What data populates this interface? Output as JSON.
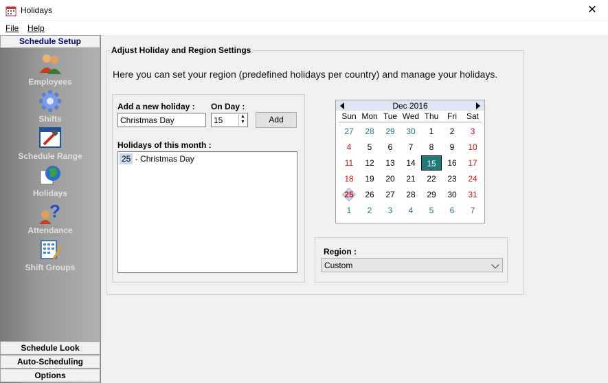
{
  "window": {
    "title": "Holidays"
  },
  "menu": {
    "file_label": "File",
    "help_label": "Help"
  },
  "sidebar": {
    "header": "Schedule Setup",
    "items": [
      {
        "label": "Employees",
        "icon": "employees-icon"
      },
      {
        "label": "Shifts",
        "icon": "gear-icon"
      },
      {
        "label": "Schedule Range",
        "icon": "schedule-range-icon"
      },
      {
        "label": "Holidays",
        "icon": "globe-icon"
      },
      {
        "label": "Attendance",
        "icon": "question-person-icon"
      },
      {
        "label": "Shift Groups",
        "icon": "calculator-icon"
      }
    ],
    "bottom": [
      "Schedule Look",
      "Auto-Scheduling",
      "Options"
    ]
  },
  "main": {
    "group_title": "Adjust Holiday and Region Settings",
    "intro": "Here you can set your region (predefined holidays per country) and manage your holidays.",
    "add_holiday_label": "Add a new holiday :",
    "on_day_label": "On Day :",
    "holiday_name_value": "Christmas Day",
    "day_value": "15",
    "add_button": "Add",
    "month_holidays_label": "Holidays of this month :",
    "holidays": [
      {
        "day": "25",
        "name": "- Christmas Day"
      }
    ],
    "region_label": "Region :",
    "region_value": "Custom"
  },
  "calendar": {
    "month": "Dec 2016",
    "weekdays": [
      "Sun",
      "Mon",
      "Tue",
      "Wed",
      "Thu",
      "Fri",
      "Sat"
    ],
    "weeks": [
      [
        "27",
        "28",
        "29",
        "30",
        "1",
        "2",
        "3"
      ],
      [
        "4",
        "5",
        "6",
        "7",
        "8",
        "9",
        "10"
      ],
      [
        "11",
        "12",
        "13",
        "14",
        "15",
        "16",
        "17"
      ],
      [
        "18",
        "19",
        "20",
        "21",
        "22",
        "23",
        "24"
      ],
      [
        "25",
        "26",
        "27",
        "28",
        "29",
        "30",
        "31"
      ],
      [
        "1",
        "2",
        "3",
        "4",
        "5",
        "6",
        "7"
      ]
    ],
    "today": "15",
    "selected": "25",
    "colors": {
      "other_month": "#1a7a8a",
      "weekend": "#d01010",
      "today_bg": "#1f7a7a"
    }
  }
}
